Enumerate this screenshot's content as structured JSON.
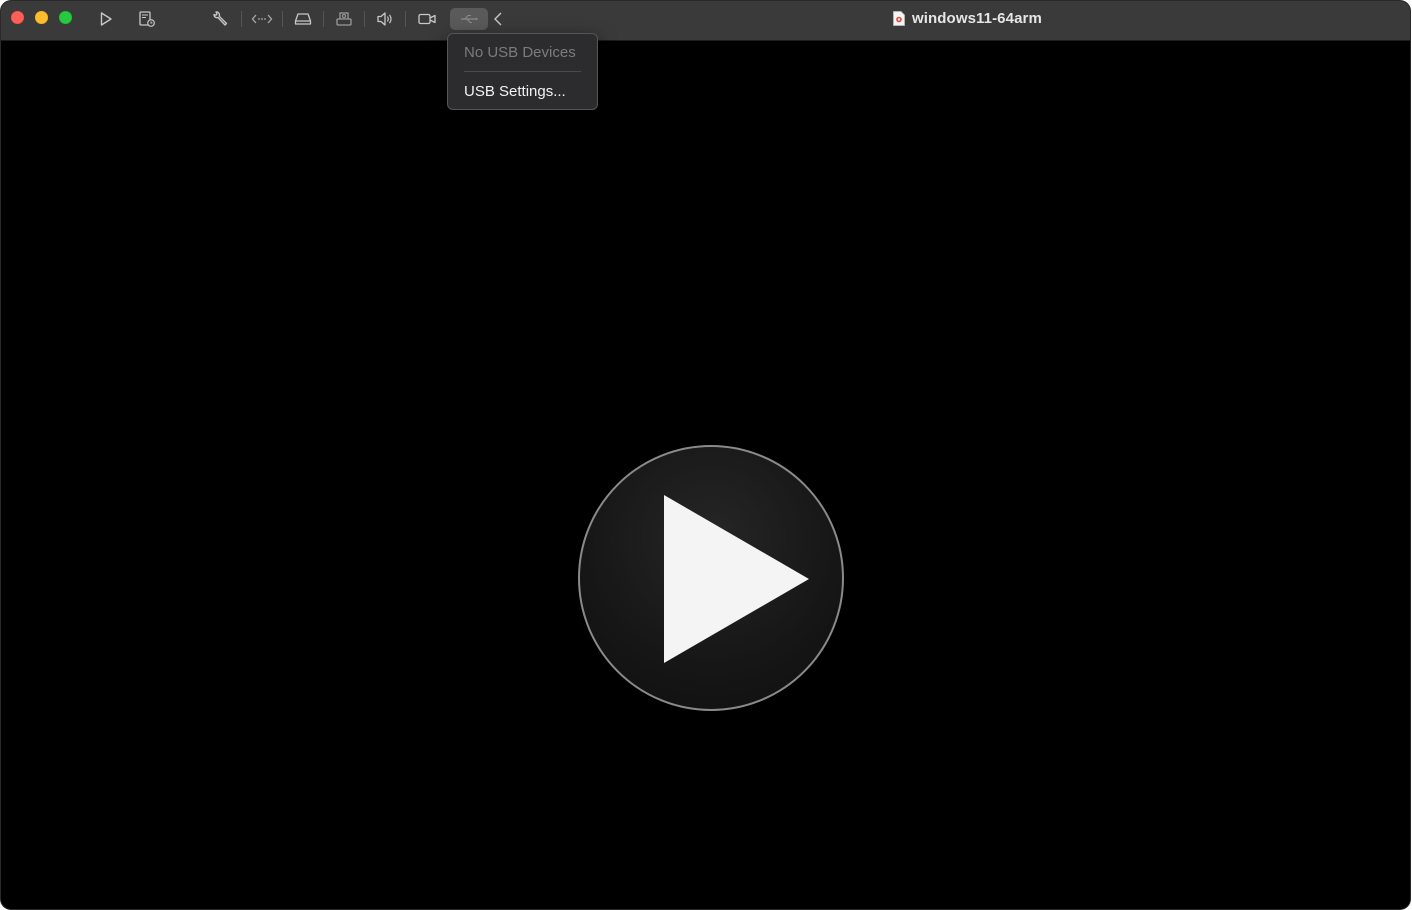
{
  "window": {
    "title": "windows11-64arm"
  },
  "toolbar": {
    "buttons": [
      {
        "name": "start",
        "icon": "play-icon"
      },
      {
        "name": "snapshot",
        "icon": "snapshot-icon"
      },
      {
        "name": "settings",
        "icon": "wrench-icon"
      },
      {
        "name": "network",
        "icon": "network-icon"
      },
      {
        "name": "hard-disk",
        "icon": "hard-disk-icon"
      },
      {
        "name": "printer",
        "icon": "printer-icon"
      },
      {
        "name": "sound",
        "icon": "speaker-icon"
      },
      {
        "name": "camera",
        "icon": "camera-icon"
      },
      {
        "name": "usb",
        "icon": "usb-icon"
      },
      {
        "name": "collapse",
        "icon": "chevron-left-icon"
      }
    ]
  },
  "usb_menu": {
    "items": [
      {
        "label": "No USB Devices",
        "enabled": false
      },
      {
        "label": "USB Settings...",
        "enabled": true
      }
    ]
  },
  "colors": {
    "titlebar": "#3a3a3a",
    "content": "#000000",
    "close": "#fe5f57",
    "minimize": "#febc2e",
    "maximize": "#28c840"
  }
}
